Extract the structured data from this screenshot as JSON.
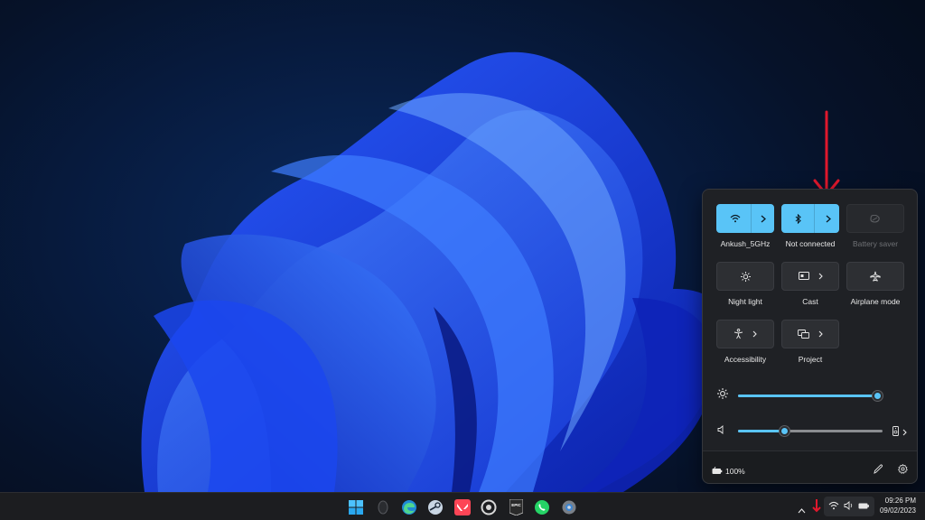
{
  "quick_settings": {
    "tiles": [
      {
        "id": "wifi",
        "label": "Ankush_5GHz",
        "state": "on"
      },
      {
        "id": "bluetooth",
        "label": "Not connected",
        "state": "on"
      },
      {
        "id": "battery-saver",
        "label": "Battery saver",
        "state": "disabled"
      },
      {
        "id": "night-light",
        "label": "Night light",
        "state": "off"
      },
      {
        "id": "cast",
        "label": "Cast",
        "state": "off"
      },
      {
        "id": "airplane-mode",
        "label": "Airplane mode",
        "state": "off"
      },
      {
        "id": "accessibility",
        "label": "Accessibility",
        "state": "off"
      },
      {
        "id": "project",
        "label": "Project",
        "state": "off"
      }
    ],
    "brightness_level": 1.0,
    "volume_level": 0.32,
    "battery_percent": "100%"
  },
  "taskbar": {
    "apps": [
      "start-icon",
      "mouse-app-icon",
      "edge-icon",
      "steam-icon",
      "valorant-icon",
      "overwolf-icon",
      "epic-games-icon",
      "whatsapp-icon",
      "settings-icon"
    ],
    "time": "09:26 PM",
    "date": "09/02/2023"
  },
  "colors": {
    "accent": "#59c4f7",
    "annotation_arrow": "#e0182d",
    "flyout_bg": "#1f2125",
    "taskbar_bg": "#1c1d20"
  }
}
